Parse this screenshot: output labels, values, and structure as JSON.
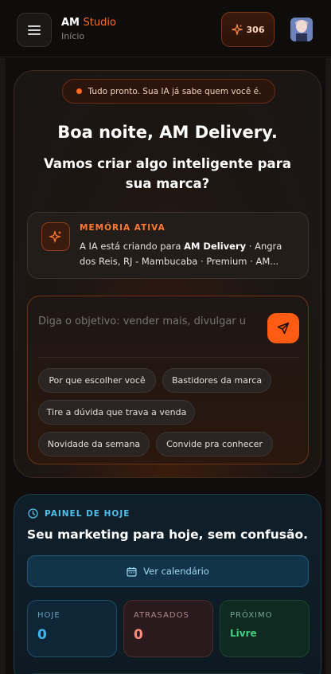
{
  "header": {
    "brand_primary": "AM",
    "brand_accent": "Studio",
    "breadcrumb": "Início",
    "credits": "306"
  },
  "hero": {
    "status": "Tudo pronto. Sua IA já sabe quem você é.",
    "greeting": "Boa noite, AM Delivery.",
    "subtitle": "Vamos criar algo inteligente para sua marca?",
    "memory": {
      "label": "MEMÓRIA ATIVA",
      "prefix": "A IA está criando para ",
      "brand": "AM Delivery",
      "details": " · Angra dos Reis, RJ - Mambucaba · Premium · AM..."
    },
    "composer": {
      "placeholder": "Diga o objetivo: vender mais, divulgar u",
      "chips": [
        "Por que escolher você",
        "Bastidores da marca",
        "Tire a dúvida que trava a venda",
        "Novidade da semana",
        "Convide pra conhecer"
      ]
    }
  },
  "panel": {
    "label": "PAINEL DE HOJE",
    "title": "Seu marketing para hoje, sem confusão.",
    "calendar_button": "Ver calendário",
    "stats": {
      "today": {
        "label": "HOJE",
        "value": "0"
      },
      "late": {
        "label": "ATRASADOS",
        "value": "0"
      },
      "next": {
        "label": "PRÓXIMO",
        "value": "Livre"
      }
    }
  },
  "colors": {
    "accent": "#ff5b12",
    "info": "#4fc0ea",
    "success": "#3fd07f",
    "danger": "#ff8c7a"
  }
}
